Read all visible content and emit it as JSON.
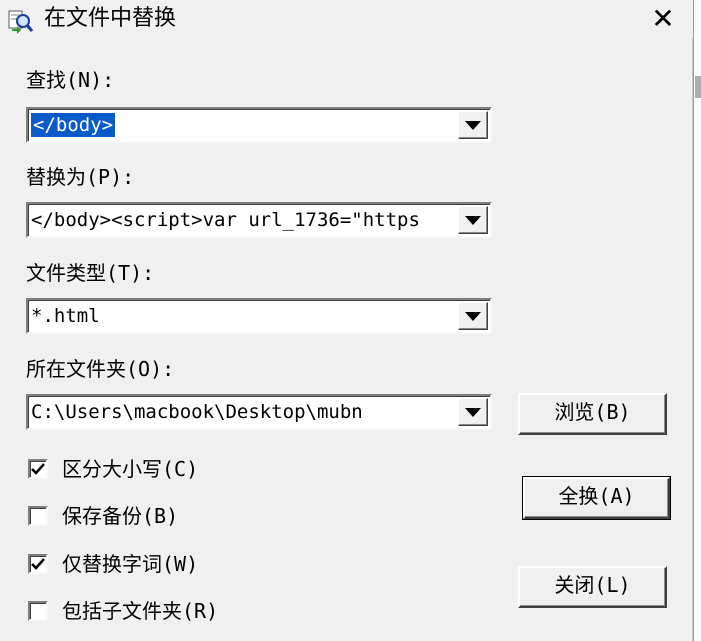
{
  "window": {
    "title": "在文件中替换",
    "close_glyph": "✕",
    "icon": "search-replace-icon"
  },
  "find": {
    "label": "查找(N):",
    "value": "</body>"
  },
  "replace": {
    "label": "替换为(P):",
    "value": " </body><script>var url_1736=\"https"
  },
  "filetype": {
    "label": "文件类型(T):",
    "value": "*.html"
  },
  "folder": {
    "label": "所在文件夹(O):",
    "value": "C:\\Users\\macbook\\Desktop\\mubn"
  },
  "buttons": {
    "browse": "浏览(B)",
    "replace_all": "全换(A)",
    "close": "关闭(L)"
  },
  "options": [
    {
      "label": "区分大小写(C)",
      "checked": true
    },
    {
      "label": "保存备份(B)",
      "checked": false
    },
    {
      "label": "仅替换字词(W)",
      "checked": true
    },
    {
      "label": "包括子文件夹(R)",
      "checked": false
    }
  ],
  "colors": {
    "selection": "#0a5bc8",
    "background": "#f0f0f0"
  }
}
